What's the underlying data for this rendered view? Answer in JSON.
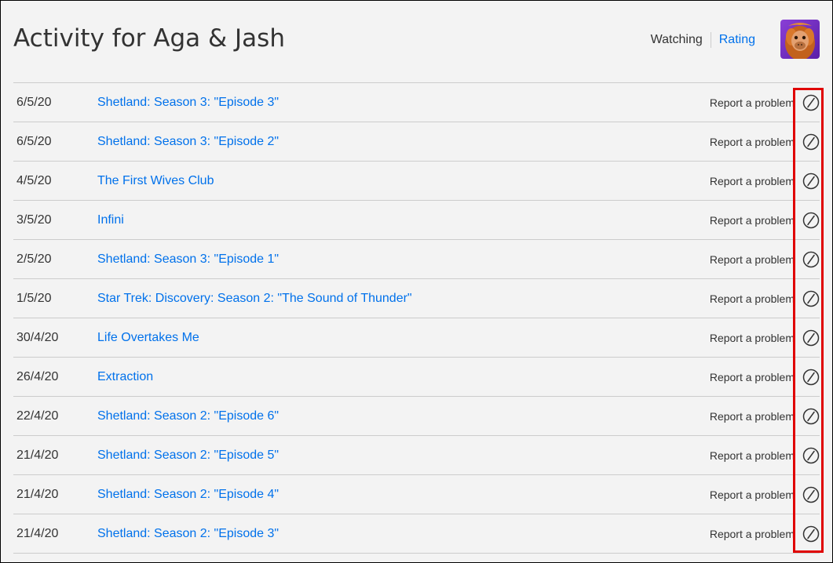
{
  "page": {
    "title": "Activity for Aga & Jash"
  },
  "view_toggle": {
    "watching_label": "Watching",
    "rating_label": "Rating"
  },
  "avatar": {
    "icon": "orangutan-avatar"
  },
  "colors": {
    "link": "#0071eb",
    "text": "#333333",
    "background": "#f3f3f3",
    "highlight": "#e00000"
  },
  "activity": {
    "report_label": "Report a problem",
    "hide_icon": "hide-from-history-icon",
    "items": [
      {
        "date": "6/5/20",
        "title": "Shetland: Season 3: \"Episode 3\""
      },
      {
        "date": "6/5/20",
        "title": "Shetland: Season 3: \"Episode 2\""
      },
      {
        "date": "4/5/20",
        "title": "The First Wives Club"
      },
      {
        "date": "3/5/20",
        "title": "Infini"
      },
      {
        "date": "2/5/20",
        "title": "Shetland: Season 3: \"Episode 1\""
      },
      {
        "date": "1/5/20",
        "title": "Star Trek: Discovery: Season 2: \"The Sound of Thunder\""
      },
      {
        "date": "30/4/20",
        "title": "Life Overtakes Me"
      },
      {
        "date": "26/4/20",
        "title": "Extraction"
      },
      {
        "date": "22/4/20",
        "title": "Shetland: Season 2: \"Episode 6\""
      },
      {
        "date": "21/4/20",
        "title": "Shetland: Season 2: \"Episode 5\""
      },
      {
        "date": "21/4/20",
        "title": "Shetland: Season 2: \"Episode 4\""
      },
      {
        "date": "21/4/20",
        "title": "Shetland: Season 2: \"Episode 3\""
      }
    ]
  }
}
